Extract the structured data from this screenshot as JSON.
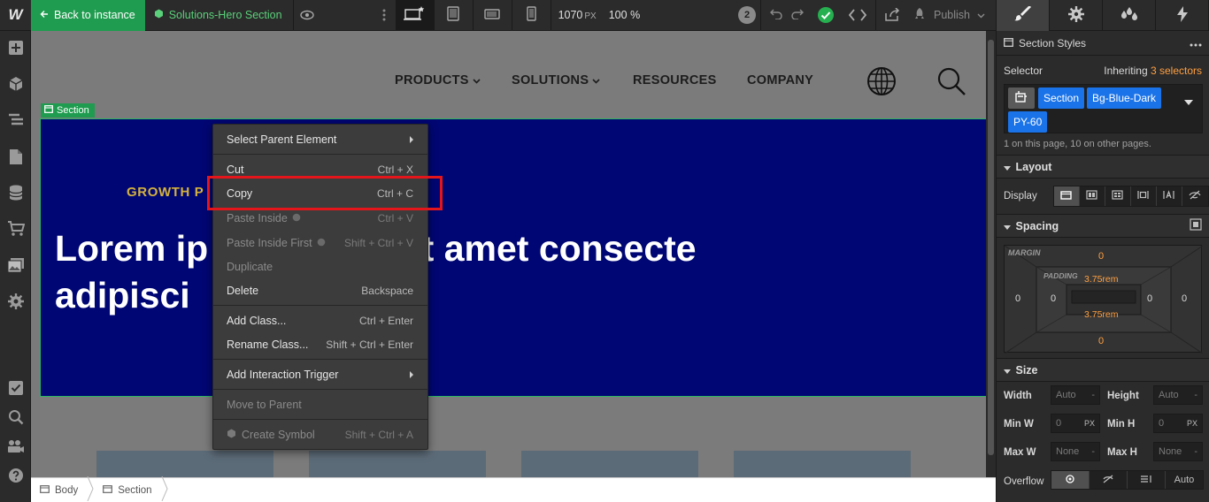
{
  "topbar": {
    "logo": "W",
    "back_label": "Back to instance",
    "symbol_name": "Solutions-Hero Section",
    "width_value": "1070",
    "width_unit": "PX",
    "zoom": "100 %",
    "pending_count": "2",
    "publish_label": "Publish"
  },
  "nav": {
    "items": [
      "PRODUCTS",
      "SOLUTIONS",
      "RESOURCES",
      "COMPANY"
    ]
  },
  "canvas": {
    "section_tag": "Section",
    "eyebrow": "GROWTH P",
    "headline_line1": "Lorem ip",
    "headline_line1b": "r sit amet consecte",
    "headline_line2": "adipisci"
  },
  "context_menu": {
    "items": [
      {
        "label": "Select Parent Element",
        "shortcut": "",
        "submenu": true,
        "disabled": false
      },
      {
        "label": "Cut",
        "shortcut": "Ctrl + X",
        "disabled": false
      },
      {
        "label": "Copy",
        "shortcut": "Ctrl + C",
        "disabled": false
      },
      {
        "label": "Paste Inside",
        "shortcut": "Ctrl + V",
        "disabled": true
      },
      {
        "label": "Paste Inside First",
        "shortcut": "Shift + Ctrl + V",
        "disabled": true
      },
      {
        "label": "Duplicate",
        "shortcut": "",
        "disabled": true
      },
      {
        "label": "Delete",
        "shortcut": "Backspace",
        "disabled": false
      },
      {
        "label": "Add Class...",
        "shortcut": "Ctrl + Enter",
        "disabled": false
      },
      {
        "label": "Rename Class...",
        "shortcut": "Shift + Ctrl + Enter",
        "disabled": false
      },
      {
        "label": "Add Interaction Trigger",
        "shortcut": "",
        "submenu": true,
        "disabled": false
      },
      {
        "label": "Move to Parent",
        "shortcut": "",
        "disabled": true
      },
      {
        "label": "Create Symbol",
        "shortcut": "Shift + Ctrl + A",
        "disabled": true
      }
    ]
  },
  "breadcrumb": {
    "items": [
      "Body",
      "Section"
    ]
  },
  "panel": {
    "header": "Section Styles",
    "selector_label": "Selector",
    "inheriting_prefix": "Inheriting",
    "inheriting_count": "3 selectors",
    "chips": [
      "Section",
      "Bg-Blue-Dark",
      "PY-60"
    ],
    "on_page": "1 on this page, 10 on other pages.",
    "layout_title": "Layout",
    "display_label": "Display",
    "spacing_title": "Spacing",
    "margin_label": "MARGIN",
    "padding_label": "PADDING",
    "margin": {
      "top": "0",
      "right": "0",
      "bottom": "0",
      "left": "0"
    },
    "padding": {
      "top": "3.75rem",
      "right": "0",
      "bottom": "3.75rem",
      "left": "0"
    },
    "size_title": "Size",
    "size": {
      "width_label": "Width",
      "width_value": "Auto",
      "height_label": "Height",
      "height_value": "Auto",
      "minw_label": "Min W",
      "minw_value": "0",
      "minw_unit": "PX",
      "minh_label": "Min H",
      "minh_value": "0",
      "minh_unit": "PX",
      "maxw_label": "Max W",
      "maxw_value": "None",
      "maxh_label": "Max H",
      "maxh_value": "None",
      "overflow_label": "Overflow",
      "overflow_auto": "Auto"
    }
  },
  "colors": {
    "accent_green": "#1f9c4f",
    "hero_bg": "#000673",
    "highlight": "#e5161b",
    "chip_blue": "#1a73e8",
    "orange": "#ff9f40"
  }
}
